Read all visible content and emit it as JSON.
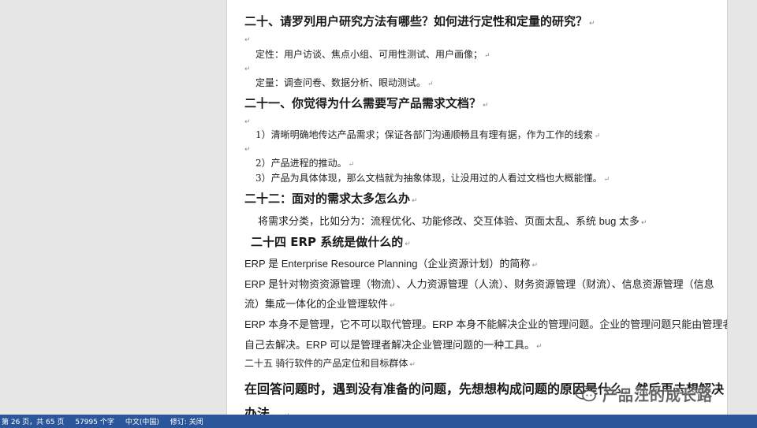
{
  "document": {
    "q20_heading": "二十、请罗列用户研究方法有哪些？如何进行定性和定量的研究？",
    "q20_qualitative": "定性：用户访谈、焦点小组、可用性测试、用户画像；",
    "q20_quantitative": "定量：调查问卷、数据分析、眼动测试。",
    "q21_heading": "二十一、你觉得为什么需要写产品需求文档？",
    "q21_point1": "1）清晰明确地传达产品需求；保证各部门沟通顺畅且有理有据，作为工作的线索",
    "q21_point2": "2）产品进程的推动。",
    "q21_point3": "3）产品为具体体现，那么文档就为抽象体现，让没用过的人看过文档也大概能懂。",
    "q22_heading": "二十二：面对的需求太多怎么办",
    "q22_answer": "将需求分类，比如分为：流程优化、功能修改、交互体验、页面太乱、系统 bug 太多",
    "q24_heading": "二十四 ERP 系统是做什么的",
    "q24_p1": "ERP 是 Enterprise Resource Planning（企业资源计划）的简称",
    "q24_p2_line1": "ERP 是针对物资资源管理（物流）、人力资源管理（人流）、财务资源管理（财流）、信息资源管理（信息",
    "q24_p2_line2": "流）集成一体化的企业管理软件",
    "q24_p3_line1": "ERP 本身不是管理，它不可以取代管理。ERP 本身不能解决企业的管理问题。企业的管理问题只能由管理者",
    "q24_p3_line2": "自己去解决。ERP 可以是管理者解决企业管理问题的一种工具。",
    "q25_heading": "二十五 骑行软件的产品定位和目标群体",
    "closing_line1": "在回答问题时，遇到没有准备的问题，先想想构成问题的原因是什么，然后再去想解决",
    "closing_line2": "办法。",
    "paragraph_mark": "↵",
    "empty_para_mark": "↵"
  },
  "watermark": {
    "text": "产品汪的成长路",
    "logo_icon": "wechat-official-account-icon"
  },
  "statusbar": {
    "page": "第 26 页，共 65 页",
    "word_count": "57995 个字",
    "language": "中文(中国)",
    "track_changes": "修订: 关闭",
    "color": "#2b579a"
  }
}
